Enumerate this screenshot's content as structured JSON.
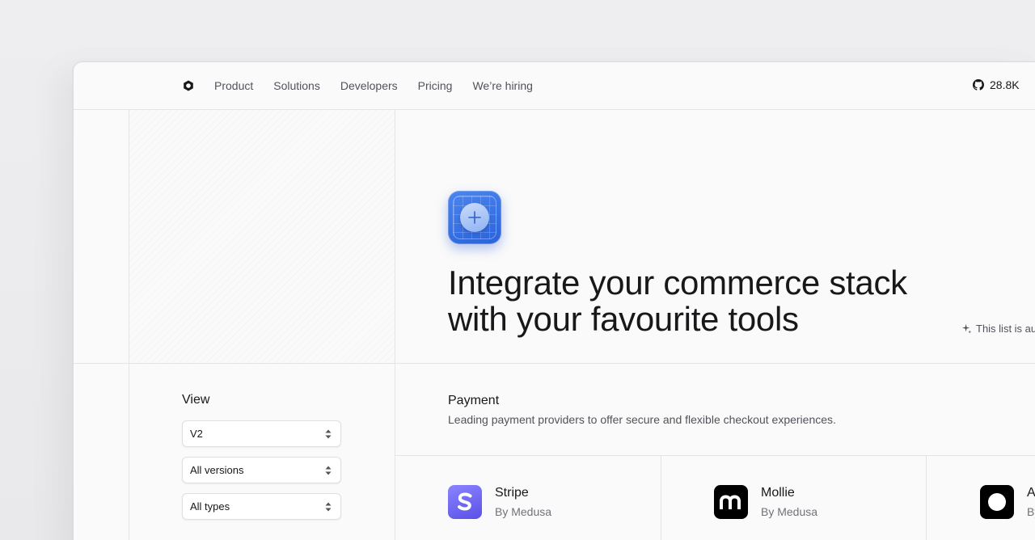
{
  "nav": {
    "logo_icon": "medusa-logo-icon",
    "links": [
      "Product",
      "Solutions",
      "Developers",
      "Pricing",
      "We’re hiring"
    ],
    "github_icon": "github-icon",
    "github_stars": "28.8K"
  },
  "hero": {
    "icon": "plus-app-icon",
    "title_line1": "Integrate your commerce stack",
    "title_line2": "with your favourite tools",
    "note": "This list is au"
  },
  "filters": {
    "label": "View",
    "selects": [
      {
        "value": "V2"
      },
      {
        "value": "All versions"
      },
      {
        "value": "All types"
      }
    ]
  },
  "section": {
    "title": "Payment",
    "description": "Leading payment providers to offer secure and flexible checkout experiences."
  },
  "cards": [
    {
      "name": "Stripe",
      "by": "By Medusa",
      "icon": "stripe-logo-icon",
      "color": "#635bff"
    },
    {
      "name": "Mollie",
      "by": "By Medusa",
      "icon": "mollie-logo-icon",
      "color": "#000000"
    },
    {
      "name": "A",
      "by": "By",
      "icon": "circle-logo-icon",
      "color": "#000000"
    }
  ],
  "colors": {
    "accent": "#2f6be0",
    "text": "#18181b",
    "muted": "#52525b"
  }
}
